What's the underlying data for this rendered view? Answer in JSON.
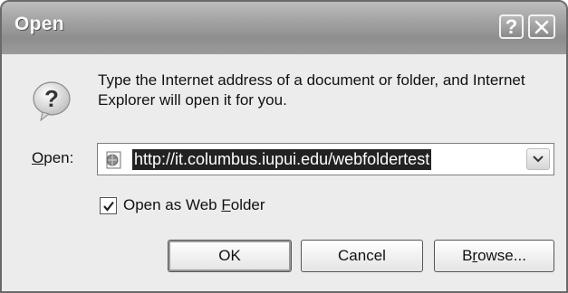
{
  "dialog": {
    "title": "Open",
    "help_glyph": "?",
    "message": "Type the Internet address of a document or folder, and Internet Explorer will open it for you.",
    "open_label_key": "O",
    "open_label_rest": "pen:",
    "url_value": "http://it.columbus.iupui.edu/webfoldertest",
    "checkbox": {
      "checked": true,
      "label_pre": "Open as Web ",
      "label_key": "F",
      "label_post": "older"
    },
    "buttons": {
      "ok": "OK",
      "cancel": "Cancel",
      "browse_pre": "B",
      "browse_key": "r",
      "browse_post": "owse..."
    },
    "icons": [
      "question-icon",
      "help-icon",
      "close-icon",
      "page-icon",
      "chevron-down-icon",
      "checkmark-icon"
    ]
  }
}
